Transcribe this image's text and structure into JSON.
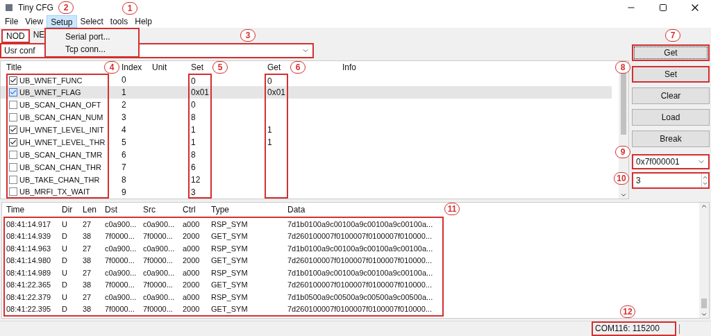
{
  "window": {
    "title": "Tiny CFG"
  },
  "menu": [
    {
      "label": "File",
      "selected": false
    },
    {
      "label": "View",
      "selected": false
    },
    {
      "label": "Setup",
      "selected": true
    },
    {
      "label": "Select",
      "selected": false
    },
    {
      "label": "tools",
      "selected": false
    },
    {
      "label": "Help",
      "selected": false
    }
  ],
  "open_menu": {
    "items": [
      "Serial port...",
      "Tcp conn..."
    ]
  },
  "tabs": [
    {
      "label": "NOD",
      "selected": true
    },
    {
      "label": "NE",
      "selected": false
    }
  ],
  "config_select": {
    "value": "Usr conf"
  },
  "table": {
    "columns": [
      "Title",
      "Index",
      "Unit",
      "Set",
      "Get",
      "Info"
    ],
    "rows": [
      {
        "title": "UB_WNET_FUNC",
        "checked": true,
        "selected": false,
        "index": "0",
        "set": "0",
        "get": "0"
      },
      {
        "title": "UB_WNET_FLAG",
        "checked": true,
        "selected": true,
        "index": "1",
        "set": "0x01",
        "get": "0x01"
      },
      {
        "title": "UB_SCAN_CHAN_OFT",
        "checked": false,
        "selected": false,
        "index": "2",
        "set": "0"
      },
      {
        "title": "UB_SCAN_CHAN_NUM",
        "checked": false,
        "selected": false,
        "index": "3",
        "set": "8"
      },
      {
        "title": "UH_WNET_LEVEL_INIT",
        "checked": true,
        "selected": false,
        "index": "4",
        "set": "1",
        "get": "1"
      },
      {
        "title": "UH_WNET_LEVEL_THR",
        "checked": true,
        "selected": false,
        "index": "5",
        "set": "1",
        "get": "1"
      },
      {
        "title": "UB_SCAN_CHAN_TMR",
        "checked": false,
        "selected": false,
        "index": "6",
        "set": "8"
      },
      {
        "title": "UB_SCAN_CHAN_THR",
        "checked": false,
        "selected": false,
        "index": "7",
        "set": "6"
      },
      {
        "title": "UB_TAKE_CHAN_THR",
        "checked": false,
        "selected": false,
        "index": "8",
        "set": "12"
      },
      {
        "title": "UB_MRFI_TX_WAIT",
        "checked": false,
        "selected": false,
        "index": "9",
        "set": "3"
      }
    ]
  },
  "buttons": [
    "Get",
    "Set",
    "Clear",
    "Load",
    "Break"
  ],
  "address_select": {
    "value": "0x7f000001"
  },
  "count_spinner": {
    "value": "3"
  },
  "log": {
    "columns": [
      "Time",
      "Dir",
      "Len",
      "Dst",
      "Src",
      "Ctrl",
      "Type",
      "Data"
    ],
    "rows": [
      [
        "08:41:14.917",
        "U",
        "27",
        "c0a900...",
        "c0a900...",
        "a000",
        "RSP_SYM",
        "7d1b0100a9c00100a9c00100a9c00100a..."
      ],
      [
        "08:41:14.939",
        "D",
        "38",
        "7f0000...",
        "7f0000...",
        "2000",
        "GET_SYM",
        "7d260100007f0100007f0100007f010000..."
      ],
      [
        "08:41:14.963",
        "U",
        "27",
        "c0a900...",
        "c0a900...",
        "a000",
        "RSP_SYM",
        "7d1b0100a9c00100a9c00100a9c00100a..."
      ],
      [
        "08:41:14.980",
        "D",
        "38",
        "7f0000...",
        "7f0000...",
        "2000",
        "GET_SYM",
        "7d260100007f0100007f0100007f010000..."
      ],
      [
        "08:41:14.989",
        "U",
        "27",
        "c0a900...",
        "c0a900...",
        "a000",
        "RSP_SYM",
        "7d1b0100a9c00100a9c00100a9c00100a..."
      ],
      [
        "08:41:22.365",
        "D",
        "38",
        "7f0000...",
        "7f0000...",
        "2000",
        "GET_SYM",
        "7d260100007f0100007f0100007f010000..."
      ],
      [
        "08:41:22.379",
        "U",
        "27",
        "c0a900...",
        "c0a900...",
        "a000",
        "RSP_SYM",
        "7d1b0500a9c00500a9c00500a9c00500a..."
      ],
      [
        "08:41:22.395",
        "D",
        "38",
        "7f0000...",
        "7f0000...",
        "2000",
        "GET_SYM",
        "7d260100007f0100007f0100007f010000..."
      ]
    ]
  },
  "status_bar": {
    "port": "COM116: 115200"
  },
  "callouts": [
    {
      "label": "1"
    },
    {
      "label": "2"
    },
    {
      "label": "3"
    },
    {
      "label": "4"
    },
    {
      "label": "5"
    },
    {
      "label": "6"
    },
    {
      "label": "7"
    },
    {
      "label": "8"
    },
    {
      "label": "9"
    },
    {
      "label": "10"
    },
    {
      "label": "11"
    },
    {
      "label": "12"
    }
  ]
}
